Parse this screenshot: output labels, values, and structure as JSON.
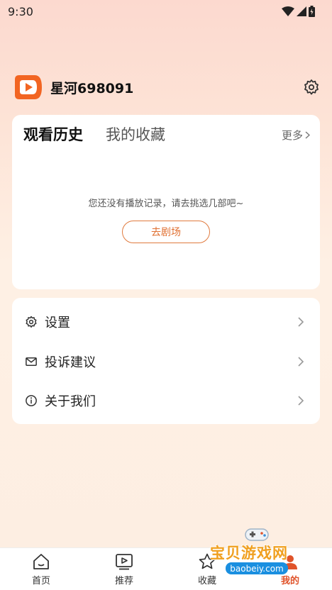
{
  "status_bar": {
    "time": "9:30"
  },
  "profile": {
    "username": "星河698091"
  },
  "history_card": {
    "tabs": [
      {
        "label": "观看历史",
        "active": true
      },
      {
        "label": "我的收藏",
        "active": false
      }
    ],
    "more_label": "更多",
    "empty_message": "您还没有播放记录，请去挑选几部吧~",
    "cta_label": "去剧场"
  },
  "menu": {
    "items": [
      {
        "label": "设置",
        "icon": "gear-icon"
      },
      {
        "label": "投诉建议",
        "icon": "mail-icon"
      },
      {
        "label": "关于我们",
        "icon": "info-icon"
      }
    ]
  },
  "bottom_nav": {
    "items": [
      {
        "label": "首页",
        "icon": "home-icon",
        "active": false
      },
      {
        "label": "推荐",
        "icon": "play-screen-icon",
        "active": false
      },
      {
        "label": "收藏",
        "icon": "star-icon",
        "active": false
      },
      {
        "label": "我的",
        "icon": "user-icon",
        "active": true
      }
    ]
  },
  "watermark": {
    "text": "宝贝游戏网",
    "url": "baobeiy.com"
  },
  "colors": {
    "accent": "#e06f30",
    "brand_orange": "#f26522",
    "active_nav": "#e0532a"
  }
}
